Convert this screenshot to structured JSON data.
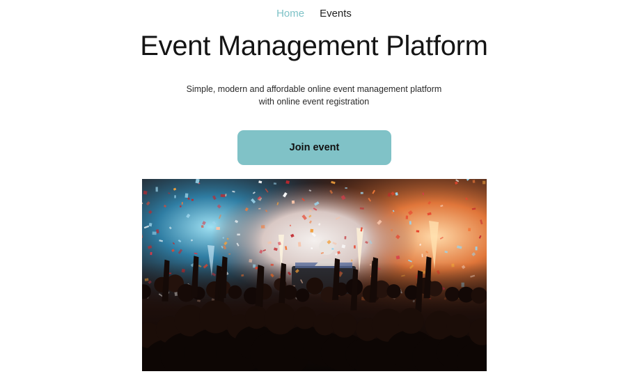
{
  "nav": {
    "items": [
      {
        "label": "Home",
        "active": true
      },
      {
        "label": "Events",
        "active": false
      }
    ],
    "active_color": "#7ec2c7"
  },
  "hero": {
    "title": "Event Management Platform",
    "subtitle_line1": "Simple, modern and affordable online event management platform",
    "subtitle_line2": "with online event registration",
    "cta_label": "Join event",
    "cta_color": "#80c2c7"
  },
  "image": {
    "subject": "concert-crowd-confetti-photo"
  }
}
